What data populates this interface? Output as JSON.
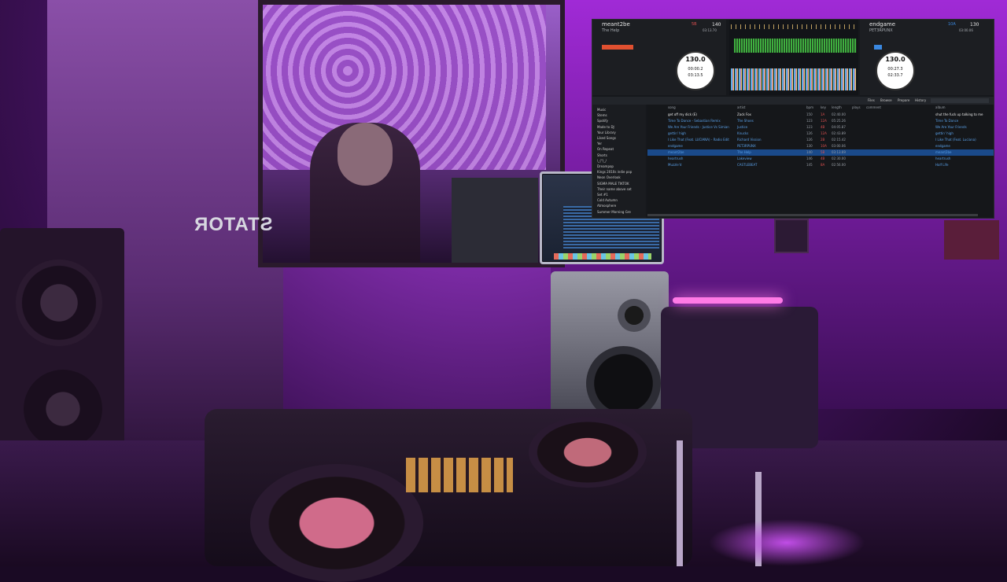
{
  "mirror": {
    "poster_text": "STATOR"
  },
  "serato": {
    "deck_left": {
      "title": "meant2be",
      "artist": "The Help",
      "key": "5B",
      "bpm": "140",
      "time": "03:13.70",
      "platter_bpm": "130.0",
      "platter_time_elapsed": "00:00.2",
      "platter_time_remain": "03:13.5"
    },
    "deck_right": {
      "title": "endgame",
      "artist": "PET3RPUNX",
      "key": "10A",
      "bpm": "130",
      "time": "03:00.06",
      "platter_bpm": "130.0",
      "platter_time_elapsed": "00:27.3",
      "platter_time_remain": "02:33.7"
    },
    "toolbar": {
      "files": "Files",
      "browse": "Browse",
      "prepare": "Prepare",
      "history": "History"
    },
    "sidebar": [
      "Music",
      "Stems",
      "Spotify",
      "Made to DJ",
      "Your Library",
      "Liked Songs",
      "Yer",
      "On Repeat",
      "Shorts",
      "\\_(°)_/",
      "Dreampop",
      "Kings 2010s indie pop",
      "Neon Overlook",
      "SIGMA MALE TIKTOK",
      "Their name above set",
      "Set #1",
      "Cold Autumn",
      "Atmosphere",
      "Summer Morning Gre"
    ],
    "columns": {
      "song": "song",
      "artist": "artist",
      "bpm": "bpm",
      "key": "key",
      "length": "length",
      "plays": "plays",
      "comment": "comment",
      "album": "album"
    },
    "tracks": [
      {
        "song": "get off my dick (E)",
        "artist": "Zack Fox",
        "bpm": "150",
        "key": "1A",
        "length": "02:40.00",
        "album": "shut the fuck up talking to me"
      },
      {
        "song": "Time To Dance - Sebastian Remix",
        "artist": "The Shoes",
        "bpm": "123",
        "key": "12A",
        "length": "05:25.26",
        "album": "Time To Dance"
      },
      {
        "song": "We Are Your Friends - Justice Vs Simian",
        "artist": "Justice",
        "bpm": "123",
        "key": "4B",
        "length": "04:05.87",
        "album": "We Are Your Friends"
      },
      {
        "song": "gettin' high",
        "artist": "Knucks",
        "bpm": "126",
        "key": "12A",
        "length": "02:43.89",
        "album": "gettin' high"
      },
      {
        "song": "I Like That (Feat. LUCIANA) - Radio Edit",
        "artist": "Richard Vission",
        "bpm": "126",
        "key": "2B",
        "length": "02:15.42",
        "album": "I Like That (Feat. Luciana)"
      },
      {
        "song": "endgame",
        "artist": "PET3RPUNX",
        "bpm": "130",
        "key": "10A",
        "length": "03:00.06",
        "album": "endgame"
      },
      {
        "song": "meant2be",
        "artist": "The Help",
        "bpm": "140",
        "key": "5B",
        "length": "03:13.69",
        "album": "meant2be",
        "selected": true
      },
      {
        "song": "heartrush",
        "artist": "Lakeview",
        "bpm": "146",
        "key": "4B",
        "length": "02:30.00",
        "album": "heartrush"
      },
      {
        "song": "Muzzle'd",
        "artist": "CASTLEBEAT",
        "bpm": "145",
        "key": "8A",
        "length": "02:56.00",
        "album": "Half Life"
      }
    ]
  },
  "colors": {
    "accent_blue": "#3a88e0",
    "key_red": "#e05050",
    "selected_row": "#1a4a8a",
    "waveform_green": "#3fb040"
  }
}
